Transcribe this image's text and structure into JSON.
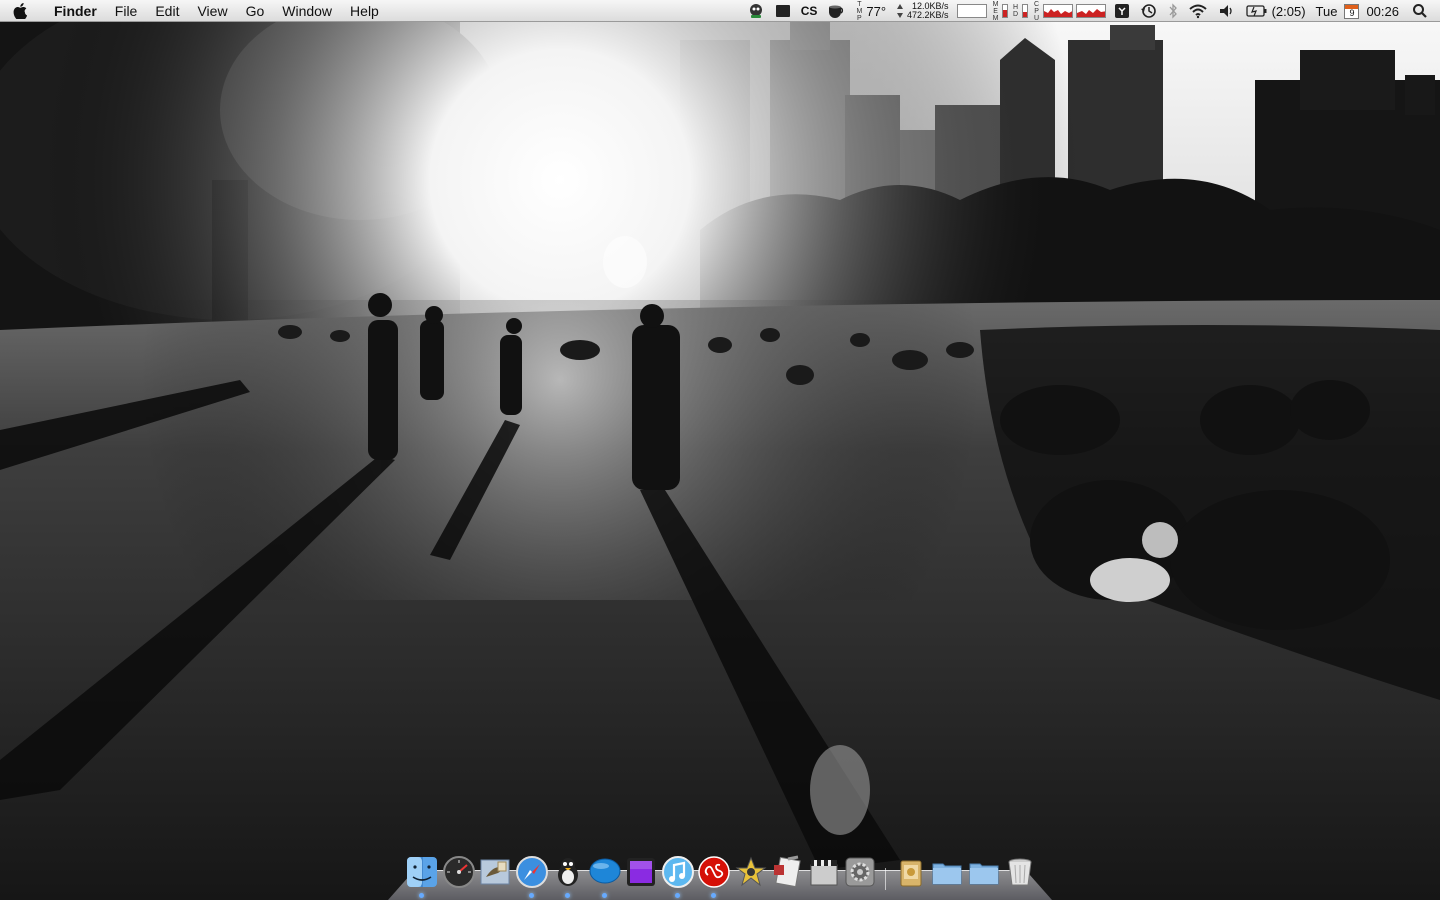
{
  "menubar": {
    "app_name": "Finder",
    "menus": [
      "File",
      "Edit",
      "View",
      "Go",
      "Window",
      "Help"
    ],
    "status": {
      "temperature": "77°",
      "temp_label": [
        "T",
        "M",
        "P"
      ],
      "net_up": "12.0KB/s",
      "net_down": "472.2KB/s",
      "mem_label": [
        "M",
        "E",
        "M"
      ],
      "hd_label": [
        "H",
        "D"
      ],
      "cpu_label": [
        "C",
        "P",
        "U"
      ],
      "battery_time": "(2:05)",
      "day": "Tue",
      "calendar_date": "9",
      "time": "00:26",
      "cs_label": "CS"
    }
  },
  "dock": {
    "apps": [
      {
        "name": "Finder",
        "icon": "finder-icon",
        "running": true
      },
      {
        "name": "Dashboard",
        "icon": "dashboard-icon",
        "running": false
      },
      {
        "name": "Mail",
        "icon": "mail-icon",
        "running": false
      },
      {
        "name": "Safari",
        "icon": "safari-icon",
        "running": true
      },
      {
        "name": "Adium",
        "icon": "adium-icon",
        "running": true
      },
      {
        "name": "Skype",
        "icon": "chat-bubble-icon",
        "running": true
      },
      {
        "name": "Photo Booth",
        "icon": "purple-app-icon",
        "running": false
      },
      {
        "name": "iTunes",
        "icon": "itunes-icon",
        "running": true
      },
      {
        "name": "Last.fm",
        "icon": "lastfm-icon",
        "running": true
      },
      {
        "name": "iMovie",
        "icon": "star-app-icon",
        "running": false
      },
      {
        "name": "Script Editor",
        "icon": "script-icon",
        "running": false
      },
      {
        "name": "Final Cut",
        "icon": "clapper-icon",
        "running": false
      },
      {
        "name": "System Preferences",
        "icon": "system-prefs-icon",
        "running": false
      }
    ],
    "stacks": [
      {
        "name": "Applications",
        "icon": "app-stack-icon"
      },
      {
        "name": "Documents",
        "icon": "folder-icon"
      },
      {
        "name": "Downloads",
        "icon": "folder-icon"
      },
      {
        "name": "Trash",
        "icon": "trash-icon"
      }
    ]
  }
}
